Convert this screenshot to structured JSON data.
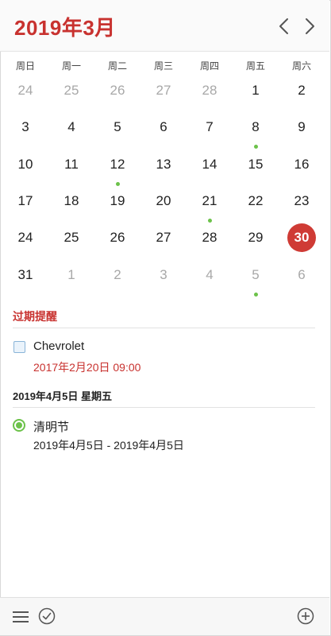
{
  "header": {
    "title": "2019年3月",
    "prev_icon": "chevron-left-icon",
    "next_icon": "chevron-right-icon",
    "accent_color": "#c8322f"
  },
  "weekdays": [
    "周日",
    "周一",
    "周二",
    "周三",
    "周四",
    "周五",
    "周六"
  ],
  "calendar": {
    "weeks": [
      [
        {
          "d": "24",
          "other": true
        },
        {
          "d": "25",
          "other": true
        },
        {
          "d": "26",
          "other": true
        },
        {
          "d": "27",
          "other": true
        },
        {
          "d": "28",
          "other": true
        },
        {
          "d": "1"
        },
        {
          "d": "2"
        }
      ],
      [
        {
          "d": "3"
        },
        {
          "d": "4"
        },
        {
          "d": "5"
        },
        {
          "d": "6"
        },
        {
          "d": "7"
        },
        {
          "d": "8",
          "dot": true
        },
        {
          "d": "9"
        }
      ],
      [
        {
          "d": "10"
        },
        {
          "d": "11"
        },
        {
          "d": "12",
          "dot": true
        },
        {
          "d": "13"
        },
        {
          "d": "14"
        },
        {
          "d": "15"
        },
        {
          "d": "16"
        }
      ],
      [
        {
          "d": "17"
        },
        {
          "d": "18"
        },
        {
          "d": "19"
        },
        {
          "d": "20"
        },
        {
          "d": "21",
          "dot": true
        },
        {
          "d": "22"
        },
        {
          "d": "23"
        }
      ],
      [
        {
          "d": "24"
        },
        {
          "d": "25"
        },
        {
          "d": "26"
        },
        {
          "d": "27"
        },
        {
          "d": "28"
        },
        {
          "d": "29"
        },
        {
          "d": "30",
          "today": true
        }
      ],
      [
        {
          "d": "31"
        },
        {
          "d": "1",
          "other": true
        },
        {
          "d": "2",
          "other": true
        },
        {
          "d": "3",
          "other": true
        },
        {
          "d": "4",
          "other": true
        },
        {
          "d": "5",
          "other": true,
          "dot": true
        },
        {
          "d": "6",
          "other": true
        }
      ]
    ],
    "event_dot_color": "#6cc24a",
    "today_color": "#cf3b35"
  },
  "overdue": {
    "heading": "过期提醒",
    "task": {
      "title": "Chevrolet",
      "date": "2017年2月20日 09:00"
    }
  },
  "upcoming": {
    "heading": "2019年4月5日 星期五",
    "event": {
      "title": "清明节",
      "range": "2019年4月5日 - 2019年4月5日"
    }
  },
  "footer": {
    "menu_icon": "hamburger-menu-icon",
    "check_icon": "checkmark-circle-icon",
    "add_icon": "plus-circle-icon"
  }
}
